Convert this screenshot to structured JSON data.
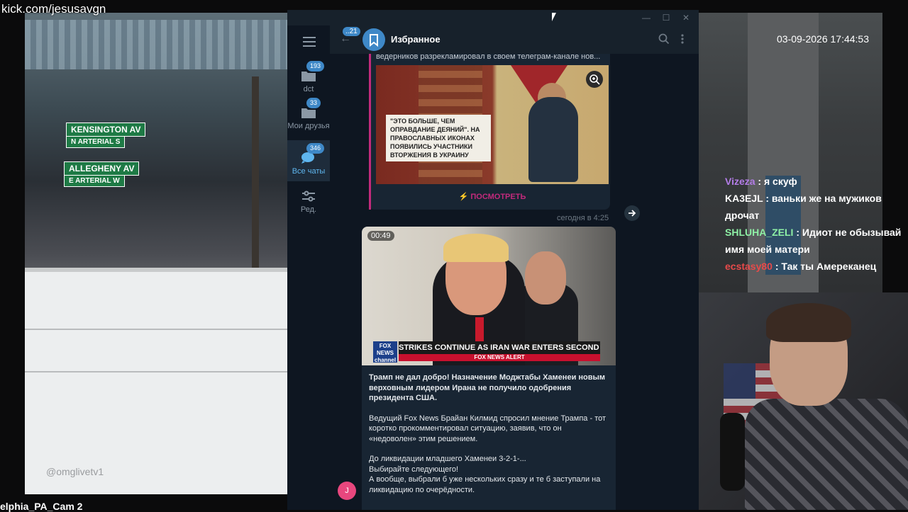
{
  "stream": {
    "url": "kick.com/jesusavgn",
    "camera_label": "elphia_PA_Cam 2",
    "timestamp": "03-09-2026 17:44:53",
    "street_signs": [
      "KENSINGTON AV",
      "N ARTERIAL S",
      "ALLEGHENY AV",
      "E ARTERIAL W"
    ],
    "watermark": "@omglivetv1"
  },
  "chat": [
    {
      "user": "Vizeza",
      "text": " : я скуф",
      "color": "#b47de8"
    },
    {
      "user": "KA3EJL",
      "text": " : ваньки же на мужиков дрочат",
      "color": "#ffffff"
    },
    {
      "user": "SHLUHA_ZELI",
      "text": " : Идиот не обызывай имя моей матери",
      "color": "#8ef0a5"
    },
    {
      "user": "ecstasy80",
      "text": " : Так ты Амереканец",
      "color": "#e84a4a"
    }
  ],
  "telegram": {
    "header": {
      "title": "Избранное",
      "back_badge": "21"
    },
    "folders": [
      {
        "label": "dct",
        "badge": "193"
      },
      {
        "label": "Мои друзья",
        "badge": "33"
      },
      {
        "label": "Все чаты",
        "badge": "346"
      },
      {
        "label": "Ред.",
        "badge": ""
      }
    ],
    "post1": {
      "lead": "ведерников разрекламировал в своем телеграм-канале нов...",
      "image_caption": "\"Это больше, чем оправдание деяний\". На православных иконах появились участники вторжения в Украину",
      "button": "⚡ ПОСМОТРЕТЬ",
      "time": "сегодня в 4:25"
    },
    "post2": {
      "duration": "00:49",
      "chyron": "STRIKES CONTINUE AS IRAN WAR ENTERS SECOND WEEK",
      "alert": "FOX NEWS ALERT",
      "network": "FOX NEWS channel",
      "para1": "Трамп не дал добро! Назначение Моджтабы Хаменеи новым верховным лидером Ирана не получило одобрения президента США.",
      "para2": "Ведущий Fox News Брайан Килмид спросил мнение Трампа - тот коротко прокомментировал ситуацию, заявив, что он «недоволен» этим решением.",
      "para3_lines": [
        "До ликвидации младшего Хаменеи 3-2-1-...",
        "Выбирайте следующего!",
        "А вообще, выбрали б уже нескольких сразу и те б заступали на ликвидацию по очерёдности."
      ]
    },
    "avatar_letter": "J",
    "accent": "#3e88c7"
  }
}
